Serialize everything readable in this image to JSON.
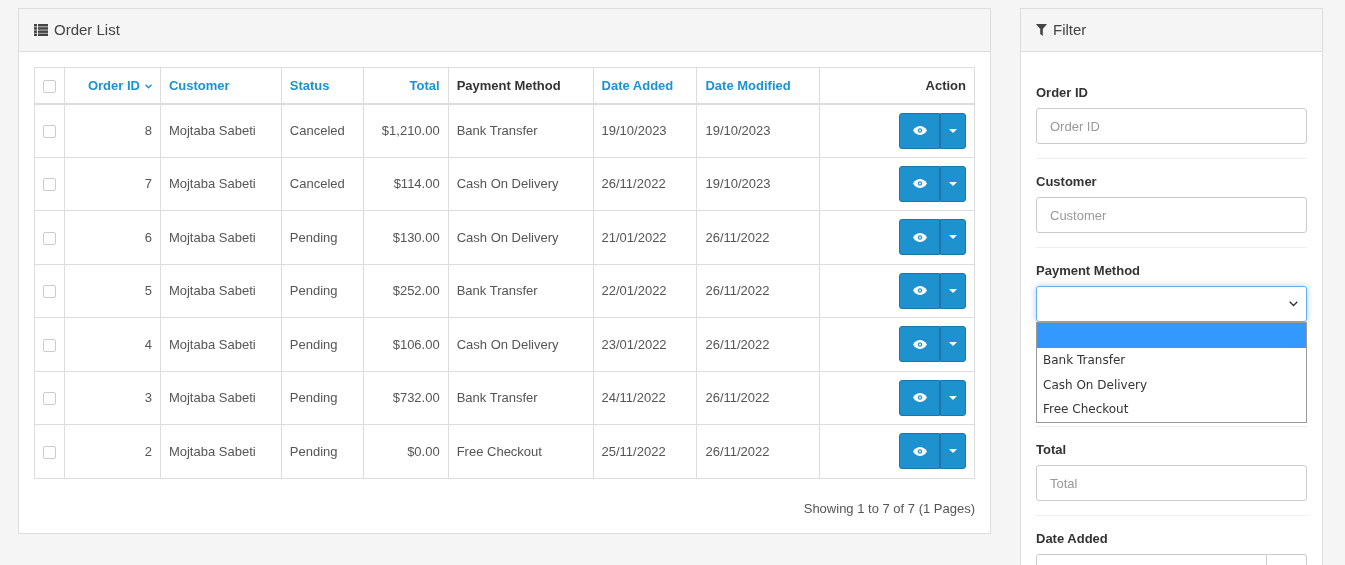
{
  "order_list": {
    "title": "Order List",
    "select_all": {
      "checked": false
    },
    "columns": [
      {
        "label": "Order ID",
        "kind": "link",
        "sorted": true
      },
      {
        "label": "Customer",
        "kind": "link",
        "sorted": false
      },
      {
        "label": "Status",
        "kind": "link",
        "sorted": false
      },
      {
        "label": "Total",
        "kind": "link",
        "sorted": false
      },
      {
        "label": "Payment Method",
        "kind": "plain",
        "sorted": false
      },
      {
        "label": "Date Added",
        "kind": "link",
        "sorted": false
      },
      {
        "label": "Date Modified",
        "kind": "link",
        "sorted": false
      },
      {
        "label": "Action",
        "kind": "plain",
        "sorted": false
      }
    ],
    "rows": [
      {
        "checked": false,
        "cells": [
          "8",
          "Mojtaba Sabeti",
          "Canceled",
          "$1,210.00",
          "Bank Transfer",
          "19/10/2023",
          "19/10/2023"
        ]
      },
      {
        "checked": false,
        "cells": [
          "7",
          "Mojtaba Sabeti",
          "Canceled",
          "$114.00",
          "Cash On Delivery",
          "26/11/2022",
          "19/10/2023"
        ]
      },
      {
        "checked": false,
        "cells": [
          "6",
          "Mojtaba Sabeti",
          "Pending",
          "$130.00",
          "Cash On Delivery",
          "21/01/2022",
          "26/11/2022"
        ]
      },
      {
        "checked": false,
        "cells": [
          "5",
          "Mojtaba Sabeti",
          "Pending",
          "$252.00",
          "Bank Transfer",
          "22/01/2022",
          "26/11/2022"
        ]
      },
      {
        "checked": false,
        "cells": [
          "4",
          "Mojtaba Sabeti",
          "Pending",
          "$106.00",
          "Cash On Delivery",
          "23/01/2022",
          "26/11/2022"
        ]
      },
      {
        "checked": false,
        "cells": [
          "3",
          "Mojtaba Sabeti",
          "Pending",
          "$732.00",
          "Bank Transfer",
          "24/11/2022",
          "26/11/2022"
        ]
      },
      {
        "checked": false,
        "cells": [
          "2",
          "Mojtaba Sabeti",
          "Pending",
          "$0.00",
          "Free Checkout",
          "25/11/2022",
          "26/11/2022"
        ]
      }
    ],
    "pagination_text": "Showing 1 to 7 of 7 (1 Pages)"
  },
  "filter": {
    "title": "Filter",
    "fields": [
      {
        "kind": "text",
        "label": "Order ID",
        "placeholder": "Order ID"
      },
      {
        "kind": "text",
        "label": "Customer",
        "placeholder": "Customer"
      },
      {
        "kind": "select",
        "label": "Payment Method",
        "expanded": true,
        "options": [
          {
            "selected": true
          },
          {
            "label": "Bank Transfer",
            "selected": false
          },
          {
            "label": "Cash On Delivery",
            "selected": false
          },
          {
            "label": "Free Checkout",
            "selected": false
          }
        ]
      },
      {
        "kind": "hidden"
      },
      {
        "kind": "text",
        "label": "Total",
        "placeholder": "Total"
      },
      {
        "kind": "date",
        "label": "Date Added"
      }
    ]
  }
}
